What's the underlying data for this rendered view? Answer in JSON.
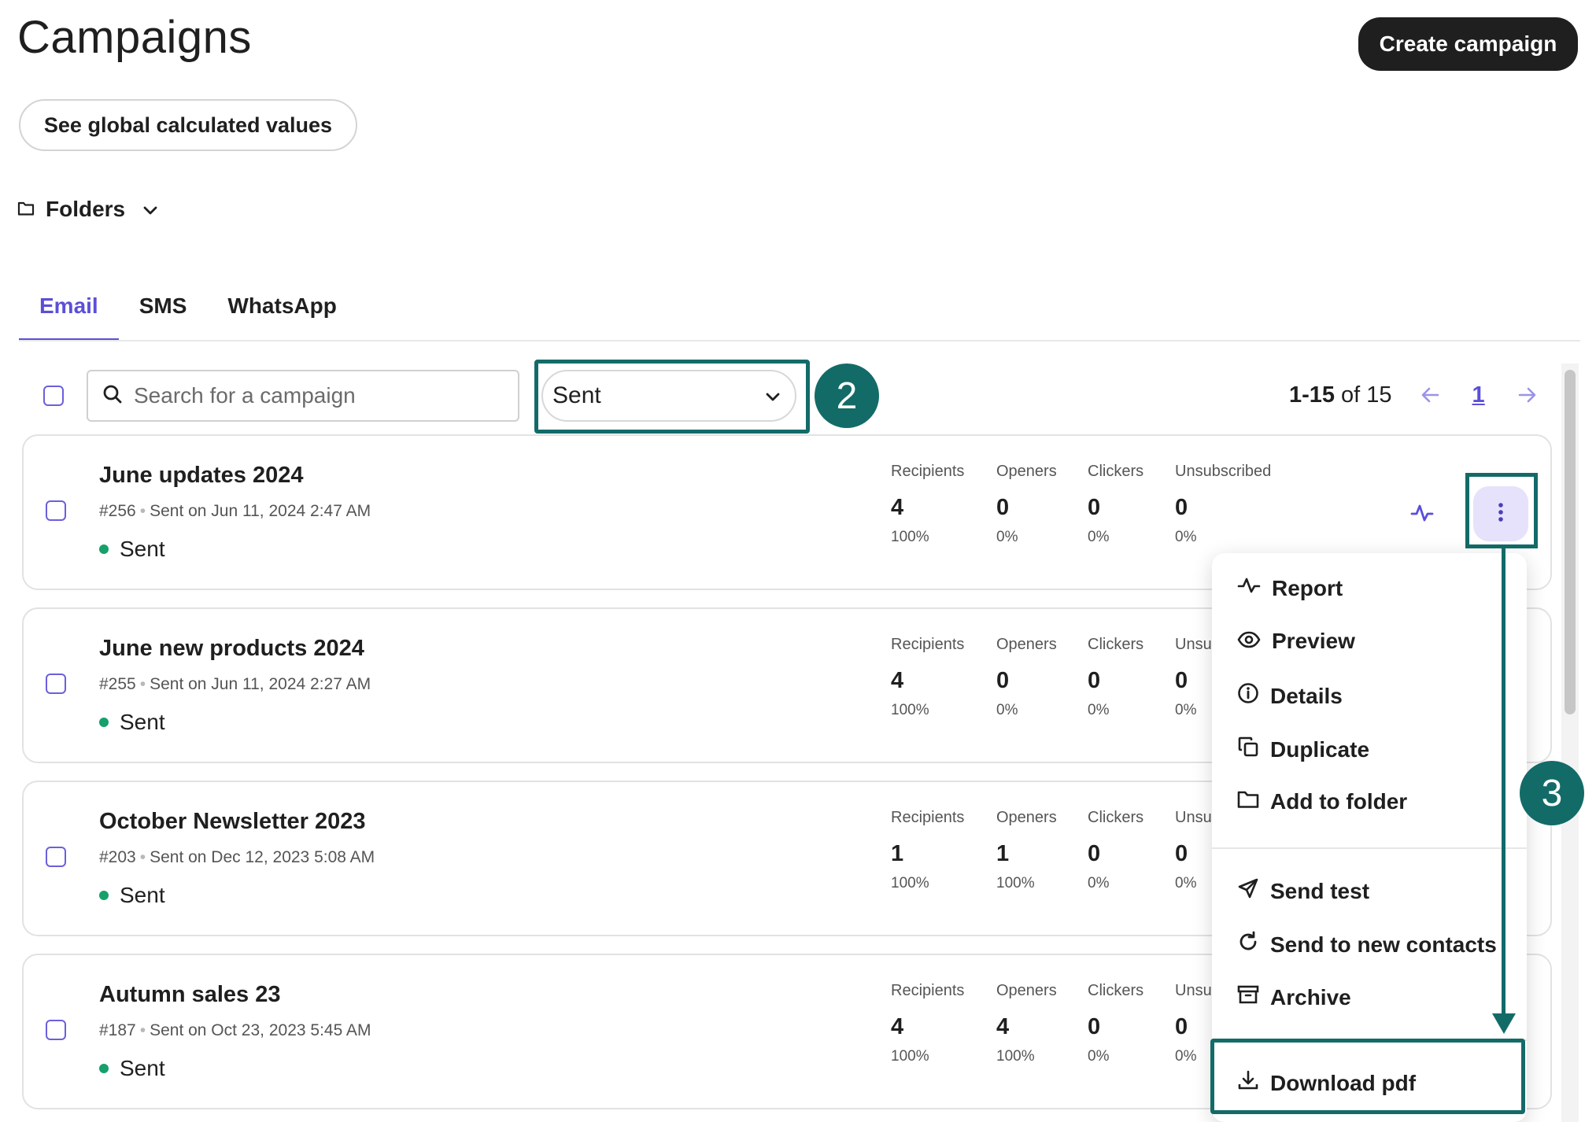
{
  "header": {
    "title": "Campaigns",
    "create_label": "Create campaign",
    "global_values_label": "See global calculated values",
    "folders_label": "Folders"
  },
  "tabs": [
    {
      "label": "Email",
      "active": true
    },
    {
      "label": "SMS",
      "active": false
    },
    {
      "label": "WhatsApp",
      "active": false
    }
  ],
  "toolbar": {
    "search_placeholder": "Search for a campaign",
    "status_filter": "Sent",
    "step_filter": "2",
    "pager_range": "1-15",
    "pager_total": "of 15",
    "pager_page": "1"
  },
  "stat_labels": [
    "Recipients",
    "Openers",
    "Clickers",
    "Unsubscribed"
  ],
  "stat_labels_truncated": "Unsu",
  "campaigns": [
    {
      "name": "June updates 2024",
      "id": "#256",
      "sent_on": "Sent on Jun 11, 2024 2:47 AM",
      "status": "Sent",
      "recipients": "4",
      "recipients_pct": "100%",
      "openers": "0",
      "openers_pct": "0%",
      "clickers": "0",
      "clickers_pct": "0%",
      "unsubscribed": "0",
      "unsubscribed_pct": "0%"
    },
    {
      "name": "June new products 2024",
      "id": "#255",
      "sent_on": "Sent on Jun 11, 2024 2:27 AM",
      "status": "Sent",
      "recipients": "4",
      "recipients_pct": "100%",
      "openers": "0",
      "openers_pct": "0%",
      "clickers": "0",
      "clickers_pct": "0%",
      "unsubscribed": "0",
      "unsubscribed_pct": "0%"
    },
    {
      "name": "October Newsletter 2023",
      "id": "#203",
      "sent_on": "Sent on Dec 12, 2023 5:08 AM",
      "status": "Sent",
      "recipients": "1",
      "recipients_pct": "100%",
      "openers": "1",
      "openers_pct": "100%",
      "clickers": "0",
      "clickers_pct": "0%",
      "unsubscribed": "0",
      "unsubscribed_pct": "0%"
    },
    {
      "name": "Autumn sales 23",
      "id": "#187",
      "sent_on": "Sent on Oct 23, 2023 5:45 AM",
      "status": "Sent",
      "recipients": "4",
      "recipients_pct": "100%",
      "openers": "4",
      "openers_pct": "100%",
      "clickers": "0",
      "clickers_pct": "0%",
      "unsubscribed": "0",
      "unsubscribed_pct": "0%"
    }
  ],
  "menu": {
    "report": "Report",
    "preview": "Preview",
    "details": "Details",
    "duplicate": "Duplicate",
    "add_to_folder": "Add to folder",
    "send_test": "Send test",
    "send_to_new_contacts": "Send to new contacts",
    "archive": "Archive",
    "download_pdf": "Download pdf"
  },
  "annotations": {
    "step_menu": "3"
  },
  "colors": {
    "accent": "#5b4fd8",
    "annotation": "#136b68",
    "sent_dot": "#16a06b",
    "dark": "#1f1f1f"
  }
}
